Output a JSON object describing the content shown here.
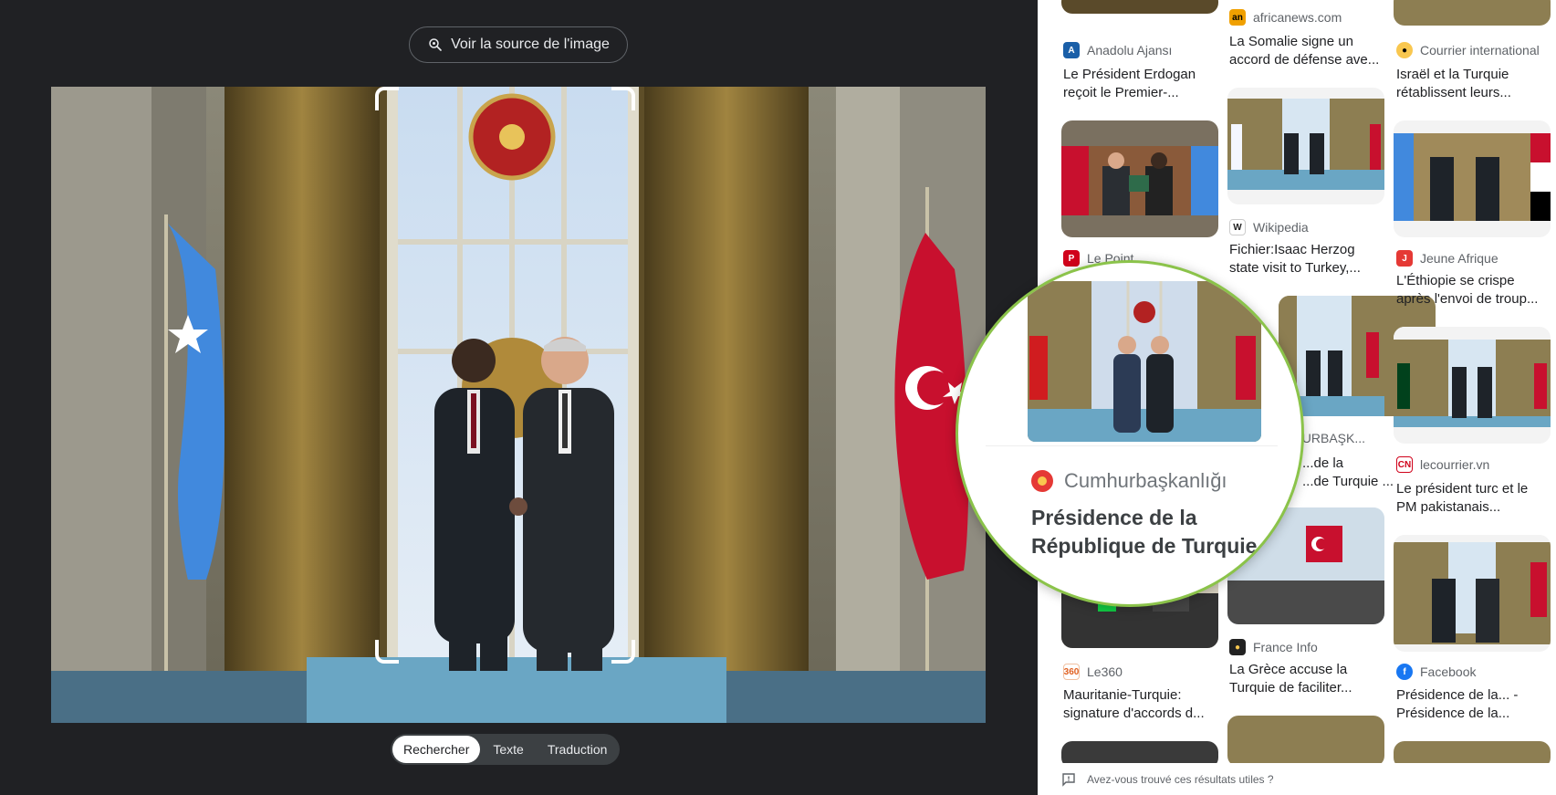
{
  "viewer": {
    "source_button_label": "Voir la source de l'image",
    "tabs": [
      "Rechercher",
      "Texte",
      "Traduction"
    ],
    "active_tab": "Rechercher"
  },
  "results": {
    "col1": [
      {
        "source": "Anadolu Ajansı",
        "title_l1": "Le Président Erdogan",
        "title_l2": "reçoit le Premier-..."
      },
      {
        "source": "Le Point",
        "title_l1": "",
        "title_l2": ""
      },
      {
        "source": "Le360",
        "title_l1": "Mauritanie-Turquie:",
        "title_l2": "signature d'accords d..."
      }
    ],
    "col2": [
      {
        "source": "africanews.com",
        "title_l1": "La Somalie signe un",
        "title_l2": "accord de défense ave..."
      },
      {
        "source": "Wikipedia",
        "title_l1": "Fichier:Isaac Herzog",
        "title_l2": "state visit to Turkey,..."
      },
      {
        "source": "...HURBAŞK...",
        "title_l1": "...de la",
        "title_l2": "...de Turquie ..."
      },
      {
        "source": "France Info",
        "title_l1": "La Grèce accuse la",
        "title_l2": "Turquie de faciliter..."
      }
    ],
    "col3": [
      {
        "source": "Courrier international",
        "title_l1": "Israël et la Turquie",
        "title_l2": "rétablissent leurs..."
      },
      {
        "source": "Jeune Afrique",
        "title_l1": "L'Éthiopie se crispe",
        "title_l2": "après l'envoi de troup..."
      },
      {
        "source": "lecourrier.vn",
        "title_l1": "Le président turc et le",
        "title_l2": "PM pakistanais..."
      },
      {
        "source": "Facebook",
        "title_l1": "Présidence de la... -",
        "title_l2": "Présidence de la..."
      }
    ]
  },
  "magnifier": {
    "source": "Cumhurbaşkanlığı",
    "title_l1": "Présidence de la",
    "title_l2": "République de Turquie ..."
  },
  "feedback": {
    "label": "Avez-vous trouvé ces résultats utiles ?"
  },
  "colors": {
    "accent_green": "#8bc34a",
    "dark_bg": "#202124"
  }
}
